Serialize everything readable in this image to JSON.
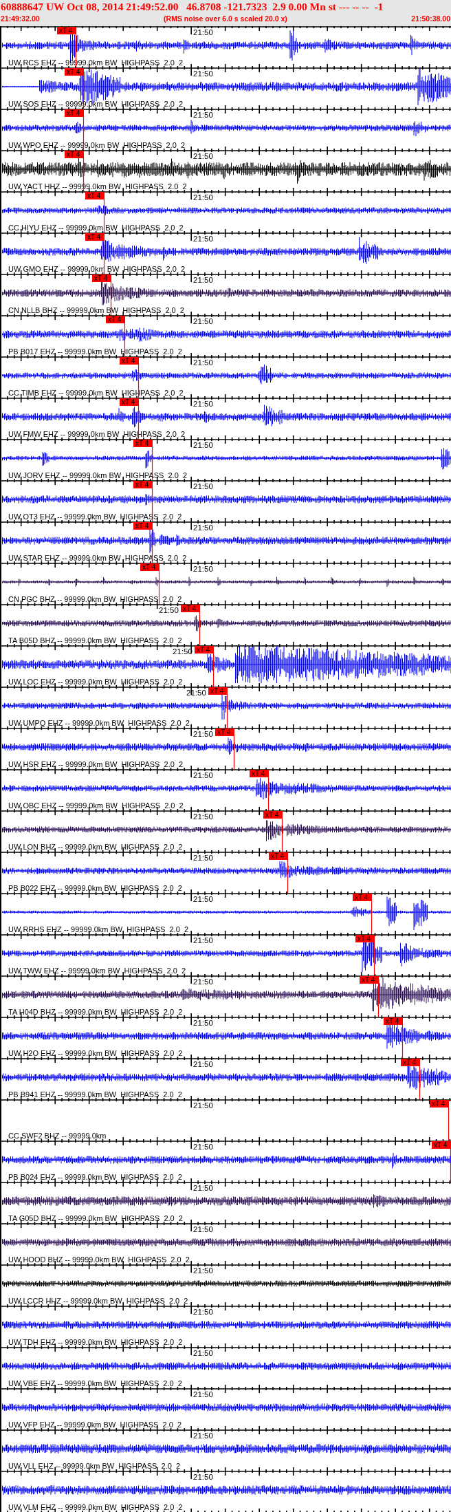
{
  "header": {
    "title": "60888647 UW Oct 08, 2014 21:49:52.00   46.8708 -121.7323  2.9 0.00 Mn st --- -- --  -1",
    "start_time": "21:49:32.00",
    "note": "(RMS noise over 6.0 s scaled 20.0 x)",
    "end_time": "21:50:38.00"
  },
  "traces": [
    {
      "kind": "waveform",
      "label": "UW RCS EHZ -- 99999.0km BW  HIGHPASS  2.0  2",
      "time_mark": "21:50",
      "color": "#0000ff",
      "pick": "xT 4"
    },
    {
      "kind": "waveform",
      "label": "UW SOS EHZ -- 99999.0km BW  HIGHPASS  2.0  2",
      "time_mark": "21:50",
      "color": "#0000ff",
      "pick": "xT 4"
    },
    {
      "kind": "waveform",
      "label": "UW WPO EHZ -- 99999.0km BW  HIGHPASS  2.0  2",
      "time_mark": "21:50",
      "color": "#0000ff",
      "pick": "xT 4"
    },
    {
      "kind": "waveform",
      "label": "UW YACT HHZ -- 99999.0km BW  HIGHPASS  2.0  2",
      "time_mark": "21:50",
      "color": "#000000",
      "pick": "xT 4"
    },
    {
      "kind": "waveform",
      "label": "CC HIYU EHZ -- 99999.0km BW  HIGHPASS  2.0  2",
      "time_mark": "21:50",
      "color": "#0000ff",
      "pick": "xT 4"
    },
    {
      "kind": "waveform",
      "label": "UW GMO EHZ -- 99999.0km BW  HIGHPASS  2.0  2",
      "time_mark": "21:50",
      "color": "#0000ff",
      "pick": "xT 4"
    },
    {
      "kind": "waveform",
      "label": "CN NLLB BHZ -- 99999.0km BW  HIGHPASS  2.0  2",
      "time_mark": "21:50",
      "color": "#2a0f52",
      "pick": "xT 4"
    },
    {
      "kind": "waveform",
      "label": "PB B017 EHZ -- 99999.0km BW  HIGHPASS  2.0  2",
      "time_mark": "21:50",
      "color": "#0000ff",
      "pick": "xT 4"
    },
    {
      "kind": "waveform",
      "label": "CC TIMB EHZ -- 99999.0km BW  HIGHPASS  2.0  2",
      "time_mark": "21:50",
      "color": "#0000ff",
      "pick": "xT 4"
    },
    {
      "kind": "waveform",
      "label": "UW FMW EHZ -- 99999.0km BW  HIGHPASS  2.0  2",
      "time_mark": "21:50",
      "color": "#0000ff",
      "pick": "xT 4"
    },
    {
      "kind": "waveform",
      "label": "UW JORV EHZ -- 99999.0km BW  HIGHPASS  2.0  2",
      "time_mark": "21:50",
      "color": "#0000ff",
      "pick": "xT 4"
    },
    {
      "kind": "waveform",
      "label": "UW OT3 EHZ -- 99999.0km BW  HIGHPASS  2.0  2",
      "time_mark": "21:50",
      "color": "#0000ff",
      "pick": "xT 4"
    },
    {
      "kind": "waveform",
      "label": "UW STAR EHZ -- 99999.0km BW  HIGHPASS  2.0  2",
      "time_mark": "21:50",
      "color": "#0000ff",
      "pick": "xT 4"
    },
    {
      "kind": "waveform",
      "label": "CN PGC BHZ -- 99999.0km BW  HIGHPASS  2.0  2",
      "time_mark": "21:50",
      "color": "#2a0f52",
      "pick": "xT 4"
    },
    {
      "kind": "waveform",
      "label": "TA B05D BHZ -- 99999.0km BW  HIGHPASS  2.0  2",
      "time_mark": "21:50",
      "color": "#2a0f52",
      "pick": "xT 4"
    },
    {
      "kind": "waveform",
      "label": "UW LOC EHZ -- 99999.0km BW  HIGHPASS  2.0  2",
      "time_mark": "21:50",
      "color": "#0000ff",
      "pick": "xT 4"
    },
    {
      "kind": "waveform",
      "label": "UW UMPQ EHZ -- 99999.0km BW  HIGHPASS  2.0  2",
      "time_mark": "21:50",
      "color": "#0000ff",
      "pick": "xT 4"
    },
    {
      "kind": "waveform",
      "label": "UW HSR EHZ -- 99999.0km BW  HIGHPASS  2.0  2",
      "time_mark": "21:50",
      "color": "#0000ff",
      "pick": "xT 4"
    },
    {
      "kind": "waveform",
      "label": "UW OBC EHZ -- 99999.0km BW  HIGHPASS  2.0  2",
      "time_mark": "21:50",
      "color": "#0000ff",
      "pick": "xT 4"
    },
    {
      "kind": "waveform",
      "label": "UW LON BHZ -- 99999.0km BW  HIGHPASS  2.0  2",
      "time_mark": "21:50",
      "color": "#2a0f52",
      "pick": "xT 4"
    },
    {
      "kind": "waveform",
      "label": "PB B022 EHZ -- 99999.0km BW  HIGHPASS  2.0  2",
      "time_mark": "21:50",
      "color": "#0000ff",
      "pick": "xT 4"
    },
    {
      "kind": "waveform",
      "label": "UW RRHS EHZ -- 99999.0km BW  HIGHPASS  2.0  2",
      "time_mark": "21:50",
      "color": "#0000ff",
      "pick": "xT 4"
    },
    {
      "kind": "waveform",
      "label": "UW TWW EHZ -- 99999.0km BW  HIGHPASS  2.0  2",
      "time_mark": "21:50",
      "color": "#0000ff",
      "pick": "xT 4"
    },
    {
      "kind": "waveform",
      "label": "TA H04D BHZ -- 99999.0km BW  HIGHPASS  2.0  2",
      "time_mark": "21:50",
      "color": "#2a0f52",
      "pick": "xT 4"
    },
    {
      "kind": "waveform",
      "label": "UW H2O EHZ -- 99999.0km BW  HIGHPASS  2.0  2",
      "time_mark": "21:50",
      "color": "#0000ff",
      "pick": "xT 4"
    },
    {
      "kind": "waveform",
      "label": "PB B941 EHZ -- 99999.0km BW  HIGHPASS  2.0  2",
      "time_mark": "21:50",
      "color": "#0000ff",
      "pick": "xT 4"
    },
    {
      "kind": "empty",
      "label": "CC SWF2 BHZ -- 99999.0km",
      "time_mark": "21:50",
      "pick": "xT 4"
    },
    {
      "kind": "waveform",
      "label": "PB B024 EHZ -- 99999.0km BW  HIGHPASS  2.0  2",
      "time_mark": "21:50",
      "color": "#0000ff",
      "pick": "xT 4"
    },
    {
      "kind": "waveform",
      "label": "TA G05D BHZ -- 99999.0km BW  HIGHPASS  2.0  2",
      "time_mark": "21:50",
      "color": "#2a0f52"
    },
    {
      "kind": "waveform",
      "label": "UW HOOD BHZ -- 99999.0km BW  HIGHPASS  2.0  2",
      "time_mark": "21:50",
      "color": "#2a0f52"
    },
    {
      "kind": "waveform",
      "label": "UW LCCR HHZ -- 99999.0km BW  HIGHPASS  2.0  2",
      "time_mark": "21:50",
      "color": "#000000"
    },
    {
      "kind": "waveform",
      "label": "UW TDH EHZ -- 99999.0km BW  HIGHPASS  2.0  2",
      "time_mark": "21:50",
      "color": "#0000ff"
    },
    {
      "kind": "waveform",
      "label": "UW VBE EHZ -- 99999.0km BW  HIGHPASS  2.0  2",
      "time_mark": "21:50",
      "color": "#0000ff"
    },
    {
      "kind": "waveform",
      "label": "UW VFP EHZ -- 99999.0km BW  HIGHPASS  2.0  2",
      "time_mark": "21:50",
      "color": "#0000ff"
    },
    {
      "kind": "waveform",
      "label": "UW VLL EHZ -- 99999.0km BW  HIGHPASS  2.0  2",
      "time_mark": "21:50",
      "color": "#0000ff"
    },
    {
      "kind": "waveform",
      "label": "UW VLM EHZ -- 99999.0km BW  HIGHPASS  2.0  2",
      "time_mark": "21:50",
      "color": "#0000ff"
    }
  ]
}
